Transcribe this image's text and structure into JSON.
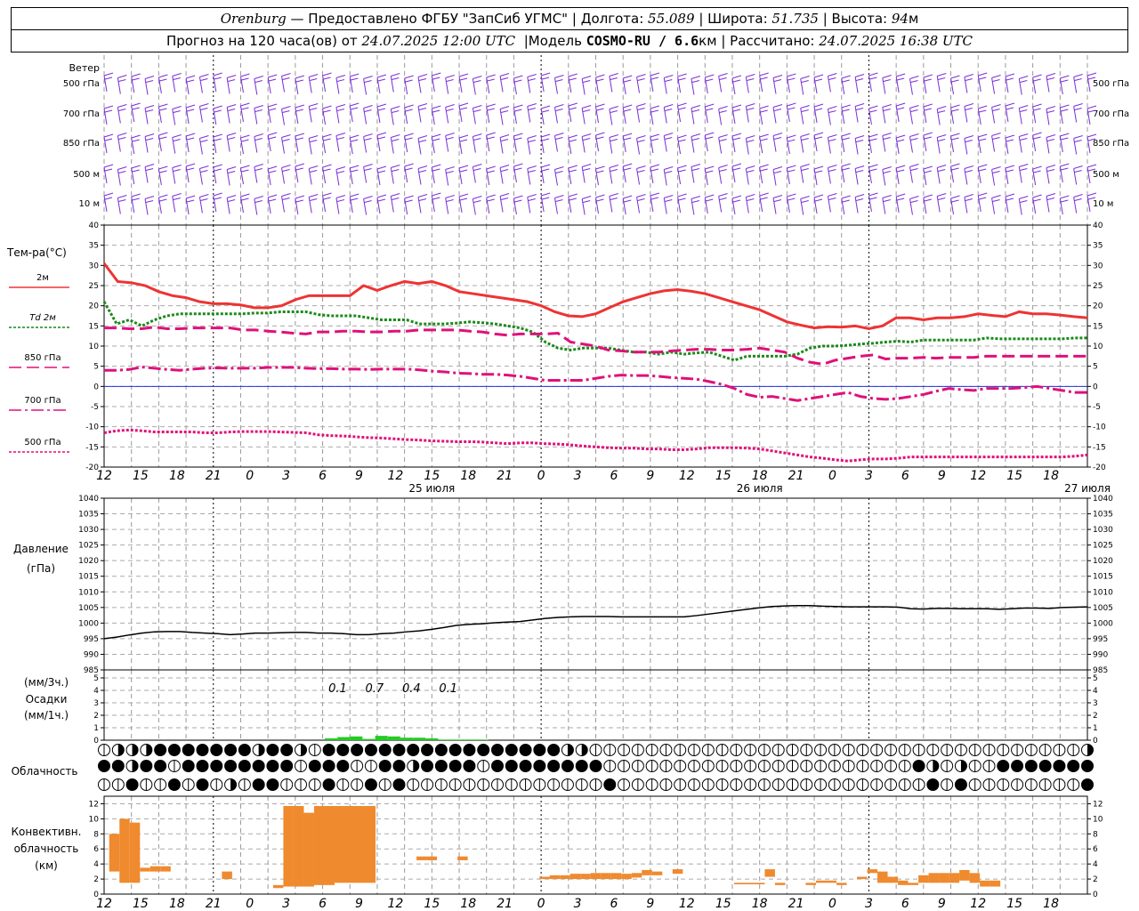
{
  "header": {
    "city": "Orenburg",
    "provider": "— Предоставлено ФГБУ \"ЗапСиб УГМС\"",
    "lon_label": "Долгота:",
    "lon": "55.089",
    "lat_label": "Широта:",
    "lat": "51.735",
    "alt_label": "Высота:",
    "alt": "94",
    "alt_unit": "м",
    "forecast_label": "Прогноз на 120 часа(ов) от",
    "forecast_time": "24.07.2025 12:00 UTC",
    "model_label": "Модель",
    "model": "COSMO-RU / 6.6",
    "model_unit": "км",
    "calc_label": "Рассчитано:",
    "calc_time": "24.07.2025 16:38 UTC",
    "sep": "|"
  },
  "chart_data": {
    "type": "line",
    "x_hours_utc": [
      12,
      13,
      14,
      15,
      16,
      17,
      18,
      19,
      20,
      21,
      22,
      23,
      0,
      1,
      2,
      3,
      4,
      5,
      6,
      7,
      8,
      9,
      10,
      11,
      12,
      13,
      14,
      15,
      16,
      17,
      18,
      19,
      20,
      21,
      22,
      23,
      0,
      1,
      2,
      3,
      4,
      5,
      6,
      7,
      8,
      9,
      10,
      11,
      12,
      13,
      14,
      15,
      16,
      17,
      18,
      19,
      20,
      21,
      22,
      23,
      0,
      1,
      2,
      3,
      4,
      5,
      6,
      7,
      8,
      9,
      10,
      11,
      12,
      13,
      14,
      15,
      16,
      17,
      18
    ],
    "x_tick_labels": [
      "12",
      "15",
      "18",
      "21",
      "0",
      "3",
      "6",
      "9",
      "12",
      "15",
      "18",
      "21",
      "0",
      "3",
      "6",
      "9",
      "12",
      "15",
      "18",
      "21",
      "0",
      "3",
      "6",
      "9",
      "12",
      "15",
      "18"
    ],
    "day_labels": [
      "25 июля",
      "26 июля",
      "27 июля"
    ],
    "wind": {
      "title": "Ветер",
      "levels": [
        "500 гПа",
        "700 гПа",
        "850 гПа",
        "500 м",
        "10  м"
      ],
      "color": "#7a2fd6"
    },
    "temperature": {
      "title": "Тем-ра(°C)",
      "ylim": [
        -20,
        40
      ],
      "yticks": [
        -20,
        -15,
        -10,
        -5,
        0,
        5,
        10,
        15,
        20,
        25,
        30,
        35,
        40
      ],
      "series": [
        {
          "name": "2м",
          "color": "#ee3333",
          "style": "solid",
          "values": [
            30.5,
            26,
            25.7,
            25,
            23.5,
            22.5,
            22,
            21,
            20.5,
            20.5,
            20.2,
            19.5,
            19.5,
            20,
            21.5,
            22.5,
            22.5,
            22.5,
            22.5,
            25,
            23.8,
            25,
            26,
            25.5,
            26,
            25,
            23.5,
            23,
            22.5,
            22,
            21.5,
            21,
            20,
            18.5,
            17.5,
            17.3,
            18,
            19.5,
            21,
            22,
            23,
            23.7,
            24,
            23.6,
            23,
            22,
            21,
            20,
            19,
            17.5,
            16,
            15.2,
            14.5,
            14.8,
            14.7,
            15,
            14.3,
            15,
            17,
            17,
            16.5,
            17,
            17,
            17.3,
            18,
            17.6,
            17.3,
            18.5,
            18,
            18,
            17.7,
            17.3,
            17
          ]
        },
        {
          "name": "Td  2м",
          "color": "#1a8a1a",
          "style": "dotted",
          "values": [
            21,
            15.5,
            16.5,
            15,
            16.5,
            17.5,
            18,
            18,
            18,
            18,
            18,
            18,
            18.2,
            18.2,
            18.5,
            18.5,
            18.5,
            17.8,
            17.5,
            17.5,
            17.5,
            17,
            16.5,
            16.5,
            16.5,
            15.5,
            15.5,
            15.5,
            15.7,
            16,
            15.8,
            15.5,
            15,
            14.5,
            13.5,
            11,
            9.5,
            9,
            9.5,
            9.5,
            9.5,
            9,
            8.5,
            8.5,
            8,
            8.5,
            8,
            8.3,
            8.5,
            7.5,
            6.5,
            7.5,
            7.5,
            7.5,
            7.5,
            8,
            9.5,
            10,
            10,
            10.2,
            10.5,
            10.7,
            11,
            11.2,
            11,
            11.5,
            11.5,
            11.5,
            11.5,
            11.5,
            12,
            11.8,
            11.8,
            11.8,
            11.8,
            11.8,
            11.8,
            12,
            12
          ]
        },
        {
          "name": "850 гПа",
          "color": "#e0107a",
          "style": "dash",
          "values": [
            14.5,
            14.5,
            14.3,
            14.3,
            14.7,
            14.3,
            14.3,
            14.5,
            14.5,
            14.5,
            14.5,
            14,
            14,
            13.7,
            13.5,
            13.2,
            13,
            13.5,
            13.5,
            13.7,
            13.7,
            13.5,
            13.5,
            13.7,
            13.7,
            14,
            14,
            14,
            14,
            13.7,
            13.5,
            13,
            12.7,
            13,
            13,
            13,
            13.2,
            11,
            10.5,
            10,
            9,
            8.8,
            8.5,
            8.5,
            8.5,
            8.8,
            9,
            9.2,
            9.2,
            9,
            9,
            9.2,
            9.5,
            9,
            8.5,
            7,
            6,
            5.5,
            6.5,
            7,
            7.5,
            7.8,
            6.8,
            7,
            7,
            7.2,
            7,
            7.2,
            7.2,
            7.2,
            7.5,
            7.5,
            7.5,
            7.5,
            7.5,
            7.5,
            7.5,
            7.5,
            7.5
          ]
        },
        {
          "name": "700 гПа",
          "color": "#e0107a",
          "style": "dashdot",
          "values": [
            4,
            4,
            4.2,
            4.8,
            4.5,
            4.2,
            4,
            4.3,
            4.5,
            4.6,
            4.5,
            4.5,
            4.5,
            4.7,
            4.7,
            4.7,
            4.5,
            4.4,
            4.4,
            4.3,
            4.3,
            4.2,
            4.3,
            4.3,
            4.3,
            4.1,
            3.8,
            3.6,
            3.3,
            3.2,
            3,
            3,
            2.8,
            2.5,
            2,
            1.5,
            1.5,
            1.5,
            1.5,
            2,
            2.5,
            2.8,
            2.7,
            2.7,
            2.5,
            2.2,
            2,
            1.8,
            1.2,
            0.5,
            -0.5,
            -2,
            -2.7,
            -2.5,
            -3,
            -3.5,
            -3,
            -2.5,
            -2,
            -1.5,
            -2.5,
            -3,
            -3.2,
            -3,
            -2.5,
            -2,
            -1.2,
            -0.5,
            -0.8,
            -1,
            -0.5,
            -0.5,
            -0.5,
            -0.3,
            0,
            -0.5,
            -1,
            -1.5,
            -1.5
          ]
        },
        {
          "name": "500 гПа",
          "color": "#e0107a",
          "style": "dotted",
          "values": [
            -11.5,
            -11,
            -10.8,
            -11,
            -11.3,
            -11.3,
            -11.3,
            -11.3,
            -11.5,
            -11.5,
            -11.3,
            -11.2,
            -11.2,
            -11.2,
            -11.3,
            -11.4,
            -11.5,
            -12,
            -12.2,
            -12.3,
            -12.5,
            -12.7,
            -12.8,
            -13,
            -13.2,
            -13.3,
            -13.5,
            -13.6,
            -13.7,
            -13.7,
            -13.8,
            -14,
            -14.2,
            -14,
            -14,
            -14.2,
            -14.3,
            -14.5,
            -14.8,
            -15,
            -15.2,
            -15.3,
            -15.3,
            -15.5,
            -15.5,
            -15.7,
            -15.7,
            -15.5,
            -15.2,
            -15.2,
            -15.2,
            -15.3,
            -15.5,
            -16,
            -16.5,
            -17,
            -17.5,
            -17.8,
            -18.2,
            -18.5,
            -18.2,
            -18,
            -18,
            -17.8,
            -17.5,
            -17.5,
            -17.5,
            -17.5,
            -17.5,
            -17.5,
            -17.5,
            -17.5,
            -17.5,
            -17.5,
            -17.5,
            -17.5,
            -17.5,
            -17.3,
            -17
          ]
        }
      ]
    },
    "pressure": {
      "title": "Давление",
      "unit": "(гПа)",
      "ylim": [
        985,
        1040
      ],
      "yticks": [
        985,
        990,
        995,
        1000,
        1005,
        1010,
        1015,
        1020,
        1025,
        1030,
        1035,
        1040
      ],
      "values": [
        995,
        995.5,
        996.2,
        996.8,
        997.2,
        997.3,
        997.3,
        997,
        996.8,
        996.6,
        996.3,
        996.5,
        996.8,
        996.8,
        996.9,
        997,
        997,
        996.8,
        996.8,
        996.6,
        996.3,
        996.3,
        996.6,
        996.8,
        997.2,
        997.5,
        998,
        998.6,
        999.3,
        999.6,
        999.8,
        1000.1,
        1000.3,
        1000.5,
        1001,
        1001.5,
        1001.8,
        1002,
        1002.1,
        1002.1,
        1002.1,
        1002,
        1002,
        1002,
        1002,
        1002,
        1002,
        1002.4,
        1002.9,
        1003.4,
        1003.9,
        1004.4,
        1004.9,
        1005.3,
        1005.5,
        1005.6,
        1005.6,
        1005.4,
        1005.3,
        1005.2,
        1005.2,
        1005.2,
        1005.2,
        1005.1,
        1004.6,
        1004.5,
        1004.7,
        1004.7,
        1004.6,
        1004.6,
        1004.6,
        1004.4,
        1004.6,
        1004.8,
        1004.8,
        1004.7,
        1005,
        1005.1,
        1005.2
      ]
    },
    "precip": {
      "title": "Осадки",
      "unit_3h": "(мм/3ч.)",
      "unit_1h": "(мм/1ч.)",
      "ylim": [
        0,
        5
      ],
      "yticks": [
        0,
        1,
        2,
        3,
        4,
        5
      ],
      "color": "#22cc22",
      "labels_3h": [
        {
          "hour_index": 19,
          "text": "0.1"
        },
        {
          "hour_index": 22,
          "text": "0.7"
        },
        {
          "hour_index": 25,
          "text": "0.4"
        },
        {
          "hour_index": 28,
          "text": "0.1"
        }
      ],
      "values_1h": [
        0,
        0,
        0,
        0,
        0,
        0,
        0,
        0,
        0,
        0,
        0,
        0,
        0,
        0,
        0,
        0,
        0,
        0,
        0.15,
        0.25,
        0.3,
        0.1,
        0.35,
        0.3,
        0.2,
        0.2,
        0.15,
        0.05,
        0.05,
        0.05,
        0.05,
        0,
        0,
        0,
        0,
        0,
        0,
        0,
        0,
        0,
        0,
        0,
        0,
        0,
        0,
        0,
        0,
        0,
        0,
        0,
        0,
        0,
        0,
        0,
        0,
        0,
        0,
        0,
        0,
        0,
        0,
        0,
        0,
        0,
        0,
        0,
        0,
        0,
        0,
        0,
        0,
        0,
        0,
        0,
        0,
        0,
        0,
        0,
        0
      ]
    },
    "cloud": {
      "title": "Облачность",
      "rows_cover": [
        "01112222222122102222222222222222211000000000000000000000000000000000001",
        "22122022222222022200221222202222222200000000000000000000002101002222222",
        "00200202010220002002020000000000000020000000000000000000000202000000002"
      ]
    },
    "convective": {
      "title": "Конвективн.",
      "title2": "облачность",
      "unit": "(км)",
      "ylim": [
        0,
        13
      ],
      "yticks": [
        0,
        2,
        4,
        6,
        8,
        10,
        12
      ],
      "color": "#ef8a2e",
      "boxes": [
        {
          "x0": 12.5,
          "x1": 13.5,
          "base": 3,
          "top": 8
        },
        {
          "x0": 13.5,
          "x1": 14.5,
          "base": 1.5,
          "top": 10
        },
        {
          "x0": 14.5,
          "x1": 15.5,
          "base": 1.5,
          "top": 9.5
        },
        {
          "x0": 15.5,
          "x1": 16.5,
          "base": 3,
          "top": 3.5
        },
        {
          "x0": 16.5,
          "x1": 17.5,
          "base": 3,
          "top": 3.7
        },
        {
          "x0": 17.5,
          "x1": 18.5,
          "base": 3,
          "top": 3.7
        },
        {
          "x0": 23.5,
          "x1": 24.5,
          "base": 2,
          "top": 3
        },
        {
          "x0": 28.5,
          "x1": 29.5,
          "base": 0.8,
          "top": 1.2
        },
        {
          "x0": 29.5,
          "x1": 30.5,
          "base": 1,
          "top": 11.7
        },
        {
          "x0": 30.5,
          "x1": 31.5,
          "base": 1,
          "top": 11.7
        },
        {
          "x0": 31.5,
          "x1": 32.5,
          "base": 1,
          "top": 10.8
        },
        {
          "x0": 32.5,
          "x1": 33.5,
          "base": 1.2,
          "top": 11.7
        },
        {
          "x0": 33.5,
          "x1": 34.5,
          "base": 1.2,
          "top": 11.7
        },
        {
          "x0": 34.5,
          "x1": 35.5,
          "base": 1.5,
          "top": 11.7
        },
        {
          "x0": 35.5,
          "x1": 36.5,
          "base": 1.5,
          "top": 11.7
        },
        {
          "x0": 36.5,
          "x1": 37.5,
          "base": 1.5,
          "top": 11.7
        },
        {
          "x0": 37.5,
          "x1": 38.5,
          "base": 1.5,
          "top": 11.7
        },
        {
          "x0": 42.5,
          "x1": 43.5,
          "base": 4.5,
          "top": 5
        },
        {
          "x0": 43.5,
          "x1": 44.5,
          "base": 4.5,
          "top": 5
        },
        {
          "x0": 46.5,
          "x1": 47.5,
          "base": 4.5,
          "top": 5
        },
        {
          "x0": 54.5,
          "x1": 55.5,
          "base": 2,
          "top": 2.3
        },
        {
          "x0": 55.5,
          "x1": 56.5,
          "base": 2,
          "top": 2.5
        },
        {
          "x0": 56.5,
          "x1": 57.5,
          "base": 2,
          "top": 2.5
        },
        {
          "x0": 57.5,
          "x1": 58.5,
          "base": 2,
          "top": 2.7
        },
        {
          "x0": 58.5,
          "x1": 59.5,
          "base": 2,
          "top": 2.7
        },
        {
          "x0": 59.5,
          "x1": 60.5,
          "base": 2,
          "top": 2.8
        },
        {
          "x0": 60.5,
          "x1": 61.5,
          "base": 2,
          "top": 2.8
        },
        {
          "x0": 61.5,
          "x1": 62.5,
          "base": 2,
          "top": 2.8
        },
        {
          "x0": 62.5,
          "x1": 63.5,
          "base": 2,
          "top": 2.7
        },
        {
          "x0": 63.5,
          "x1": 64.5,
          "base": 2.2,
          "top": 2.8
        },
        {
          "x0": 64.5,
          "x1": 65.5,
          "base": 2.5,
          "top": 3.2
        },
        {
          "x0": 65.5,
          "x1": 66.5,
          "base": 2.5,
          "top": 3
        },
        {
          "x0": 67.5,
          "x1": 68.5,
          "base": 2.7,
          "top": 3.3
        },
        {
          "x0": 73.5,
          "x1": 74.5,
          "base": 1.3,
          "top": 1.5
        },
        {
          "x0": 74.5,
          "x1": 75.5,
          "base": 1.3,
          "top": 1.5
        },
        {
          "x0": 75.5,
          "x1": 76.5,
          "base": 1.3,
          "top": 1.5
        },
        {
          "x0": 76.5,
          "x1": 77.5,
          "base": 2.3,
          "top": 3.3
        },
        {
          "x0": 77.5,
          "x1": 78.5,
          "base": 1.2,
          "top": 1.5
        },
        {
          "x0": 80.5,
          "x1": 81.5,
          "base": 1.2,
          "top": 1.5
        },
        {
          "x0": 81.5,
          "x1": 82.5,
          "base": 1.5,
          "top": 1.8
        },
        {
          "x0": 82.5,
          "x1": 83.5,
          "base": 1.5,
          "top": 1.8
        },
        {
          "x0": 83.5,
          "x1": 84.5,
          "base": 1.2,
          "top": 1.5
        },
        {
          "x0": 85.5,
          "x1": 86.5,
          "base": 2,
          "top": 2.3
        },
        {
          "x0": 86.5,
          "x1": 87.5,
          "base": 2.8,
          "top": 3.3
        },
        {
          "x0": 87.5,
          "x1": 88.5,
          "base": 1.5,
          "top": 3
        },
        {
          "x0": 88.5,
          "x1": 89.5,
          "base": 1.5,
          "top": 2.3
        },
        {
          "x0": 89.5,
          "x1": 90.5,
          "base": 1.2,
          "top": 1.8
        },
        {
          "x0": 90.5,
          "x1": 91.5,
          "base": 1.2,
          "top": 1.5
        },
        {
          "x0": 91.5,
          "x1": 92.5,
          "base": 1.5,
          "top": 2.5
        },
        {
          "x0": 92.5,
          "x1": 93.5,
          "base": 1.5,
          "top": 2.8
        },
        {
          "x0": 93.5,
          "x1": 94.5,
          "base": 1.5,
          "top": 2.8
        },
        {
          "x0": 94.5,
          "x1": 95.5,
          "base": 1.5,
          "top": 2.8
        },
        {
          "x0": 95.5,
          "x1": 96.5,
          "base": 1.8,
          "top": 3.2
        },
        {
          "x0": 96.5,
          "x1": 97.5,
          "base": 1.5,
          "top": 2.8
        },
        {
          "x0": 97.5,
          "x1": 98.5,
          "base": 1,
          "top": 1.8
        },
        {
          "x0": 98.5,
          "x1": 99.5,
          "base": 1,
          "top": 1.8
        }
      ]
    }
  }
}
